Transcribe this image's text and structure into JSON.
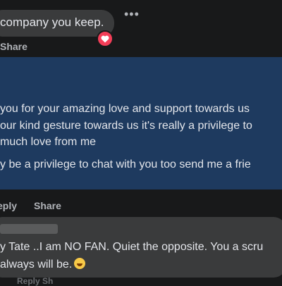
{
  "top_comment": {
    "text": "company you keep.",
    "more_label": "•••",
    "action_share": "Share"
  },
  "highlight_post": {
    "lines": [
      "you for your amazing love and support towards us",
      "our kind gesture towards us it's really a privilege to",
      "much love from me",
      "y be a privilege to chat with you too send me a frie"
    ]
  },
  "post_actions": {
    "reply": "eply",
    "share": "Share"
  },
  "bottom_comment": {
    "lines": [
      "y Tate ..I am NO FAN. Quiet the opposite. You a scru",
      "always will be."
    ],
    "emoji": "rolling-laughing-emoji",
    "faint_actions": "Reply   Sh"
  },
  "colors": {
    "background": "#18191a",
    "bubble": "#3a3b3c",
    "highlight": "#1e3a5f",
    "heart": "#f33e58"
  }
}
